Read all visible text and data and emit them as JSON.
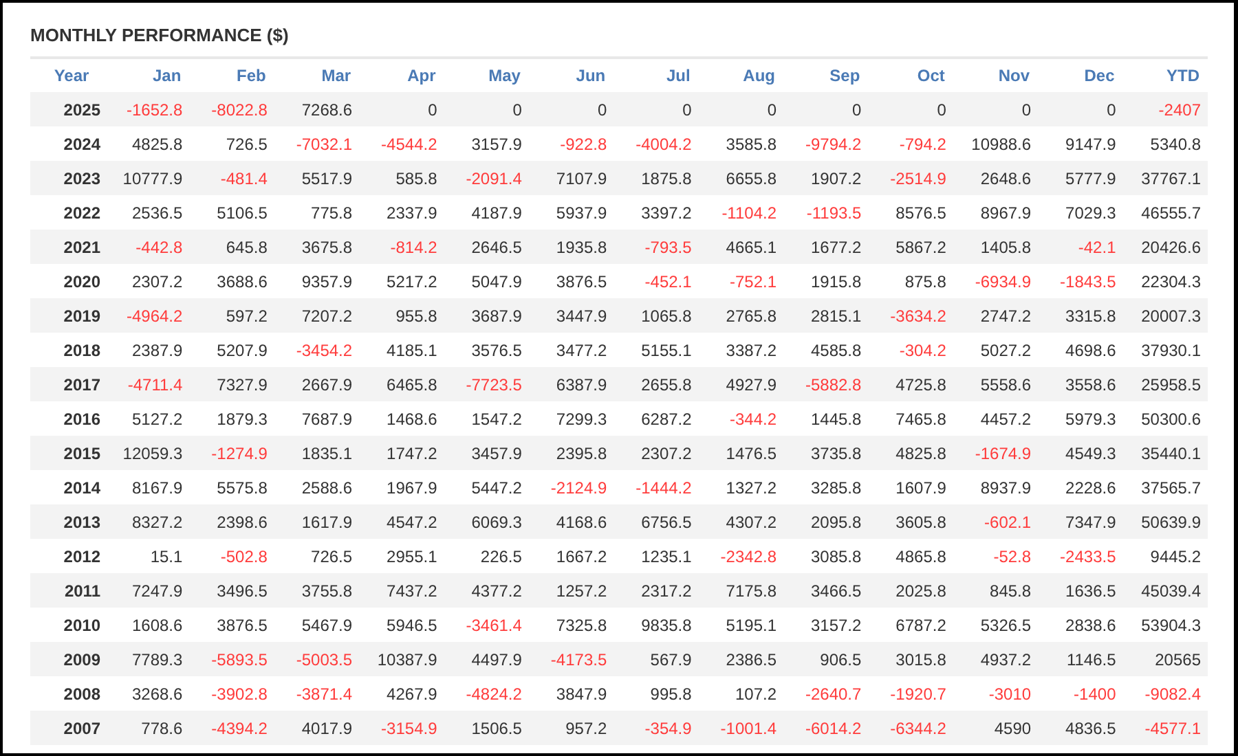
{
  "title": "MONTHLY PERFORMANCE ($)",
  "table": {
    "columns": [
      "Year",
      "Jan",
      "Feb",
      "Mar",
      "Apr",
      "May",
      "Jun",
      "Jul",
      "Aug",
      "Sep",
      "Oct",
      "Nov",
      "Dec",
      "YTD"
    ],
    "rows": [
      {
        "cells": [
          {
            "kind": "year",
            "value": "2025",
            "negative": false
          },
          {
            "kind": "number",
            "value": "-1652.8",
            "negative": true
          },
          {
            "kind": "number",
            "value": "-8022.8",
            "negative": true
          },
          {
            "kind": "number",
            "value": "7268.6",
            "negative": false
          },
          {
            "kind": "number",
            "value": "0",
            "negative": false
          },
          {
            "kind": "number",
            "value": "0",
            "negative": false
          },
          {
            "kind": "number",
            "value": "0",
            "negative": false
          },
          {
            "kind": "number",
            "value": "0",
            "negative": false
          },
          {
            "kind": "number",
            "value": "0",
            "negative": false
          },
          {
            "kind": "number",
            "value": "0",
            "negative": false
          },
          {
            "kind": "number",
            "value": "0",
            "negative": false
          },
          {
            "kind": "number",
            "value": "0",
            "negative": false
          },
          {
            "kind": "number",
            "value": "0",
            "negative": false
          },
          {
            "kind": "number",
            "value": "-2407",
            "negative": true
          }
        ]
      },
      {
        "cells": [
          {
            "kind": "year",
            "value": "2024",
            "negative": false
          },
          {
            "kind": "number",
            "value": "4825.8",
            "negative": false
          },
          {
            "kind": "number",
            "value": "726.5",
            "negative": false
          },
          {
            "kind": "number",
            "value": "-7032.1",
            "negative": true
          },
          {
            "kind": "number",
            "value": "-4544.2",
            "negative": true
          },
          {
            "kind": "number",
            "value": "3157.9",
            "negative": false
          },
          {
            "kind": "number",
            "value": "-922.8",
            "negative": true
          },
          {
            "kind": "number",
            "value": "-4004.2",
            "negative": true
          },
          {
            "kind": "number",
            "value": "3585.8",
            "negative": false
          },
          {
            "kind": "number",
            "value": "-9794.2",
            "negative": true
          },
          {
            "kind": "number",
            "value": "-794.2",
            "negative": true
          },
          {
            "kind": "number",
            "value": "10988.6",
            "negative": false
          },
          {
            "kind": "number",
            "value": "9147.9",
            "negative": false
          },
          {
            "kind": "number",
            "value": "5340.8",
            "negative": false
          }
        ]
      },
      {
        "cells": [
          {
            "kind": "year",
            "value": "2023",
            "negative": false
          },
          {
            "kind": "number",
            "value": "10777.9",
            "negative": false
          },
          {
            "kind": "number",
            "value": "-481.4",
            "negative": true
          },
          {
            "kind": "number",
            "value": "5517.9",
            "negative": false
          },
          {
            "kind": "number",
            "value": "585.8",
            "negative": false
          },
          {
            "kind": "number",
            "value": "-2091.4",
            "negative": true
          },
          {
            "kind": "number",
            "value": "7107.9",
            "negative": false
          },
          {
            "kind": "number",
            "value": "1875.8",
            "negative": false
          },
          {
            "kind": "number",
            "value": "6655.8",
            "negative": false
          },
          {
            "kind": "number",
            "value": "1907.2",
            "negative": false
          },
          {
            "kind": "number",
            "value": "-2514.9",
            "negative": true
          },
          {
            "kind": "number",
            "value": "2648.6",
            "negative": false
          },
          {
            "kind": "number",
            "value": "5777.9",
            "negative": false
          },
          {
            "kind": "number",
            "value": "37767.1",
            "negative": false
          }
        ]
      },
      {
        "cells": [
          {
            "kind": "year",
            "value": "2022",
            "negative": false
          },
          {
            "kind": "number",
            "value": "2536.5",
            "negative": false
          },
          {
            "kind": "number",
            "value": "5106.5",
            "negative": false
          },
          {
            "kind": "number",
            "value": "775.8",
            "negative": false
          },
          {
            "kind": "number",
            "value": "2337.9",
            "negative": false
          },
          {
            "kind": "number",
            "value": "4187.9",
            "negative": false
          },
          {
            "kind": "number",
            "value": "5937.9",
            "negative": false
          },
          {
            "kind": "number",
            "value": "3397.2",
            "negative": false
          },
          {
            "kind": "number",
            "value": "-1104.2",
            "negative": true
          },
          {
            "kind": "number",
            "value": "-1193.5",
            "negative": true
          },
          {
            "kind": "number",
            "value": "8576.5",
            "negative": false
          },
          {
            "kind": "number",
            "value": "8967.9",
            "negative": false
          },
          {
            "kind": "number",
            "value": "7029.3",
            "negative": false
          },
          {
            "kind": "number",
            "value": "46555.7",
            "negative": false
          }
        ]
      },
      {
        "cells": [
          {
            "kind": "year",
            "value": "2021",
            "negative": false
          },
          {
            "kind": "number",
            "value": "-442.8",
            "negative": true
          },
          {
            "kind": "number",
            "value": "645.8",
            "negative": false
          },
          {
            "kind": "number",
            "value": "3675.8",
            "negative": false
          },
          {
            "kind": "number",
            "value": "-814.2",
            "negative": true
          },
          {
            "kind": "number",
            "value": "2646.5",
            "negative": false
          },
          {
            "kind": "number",
            "value": "1935.8",
            "negative": false
          },
          {
            "kind": "number",
            "value": "-793.5",
            "negative": true
          },
          {
            "kind": "number",
            "value": "4665.1",
            "negative": false
          },
          {
            "kind": "number",
            "value": "1677.2",
            "negative": false
          },
          {
            "kind": "number",
            "value": "5867.2",
            "negative": false
          },
          {
            "kind": "number",
            "value": "1405.8",
            "negative": false
          },
          {
            "kind": "number",
            "value": "-42.1",
            "negative": true
          },
          {
            "kind": "number",
            "value": "20426.6",
            "negative": false
          }
        ]
      },
      {
        "cells": [
          {
            "kind": "year",
            "value": "2020",
            "negative": false
          },
          {
            "kind": "number",
            "value": "2307.2",
            "negative": false
          },
          {
            "kind": "number",
            "value": "3688.6",
            "negative": false
          },
          {
            "kind": "number",
            "value": "9357.9",
            "negative": false
          },
          {
            "kind": "number",
            "value": "5217.2",
            "negative": false
          },
          {
            "kind": "number",
            "value": "5047.9",
            "negative": false
          },
          {
            "kind": "number",
            "value": "3876.5",
            "negative": false
          },
          {
            "kind": "number",
            "value": "-452.1",
            "negative": true
          },
          {
            "kind": "number",
            "value": "-752.1",
            "negative": true
          },
          {
            "kind": "number",
            "value": "1915.8",
            "negative": false
          },
          {
            "kind": "number",
            "value": "875.8",
            "negative": false
          },
          {
            "kind": "number",
            "value": "-6934.9",
            "negative": true
          },
          {
            "kind": "number",
            "value": "-1843.5",
            "negative": true
          },
          {
            "kind": "number",
            "value": "22304.3",
            "negative": false
          }
        ]
      },
      {
        "cells": [
          {
            "kind": "year",
            "value": "2019",
            "negative": false
          },
          {
            "kind": "number",
            "value": "-4964.2",
            "negative": true
          },
          {
            "kind": "number",
            "value": "597.2",
            "negative": false
          },
          {
            "kind": "number",
            "value": "7207.2",
            "negative": false
          },
          {
            "kind": "number",
            "value": "955.8",
            "negative": false
          },
          {
            "kind": "number",
            "value": "3687.9",
            "negative": false
          },
          {
            "kind": "number",
            "value": "3447.9",
            "negative": false
          },
          {
            "kind": "number",
            "value": "1065.8",
            "negative": false
          },
          {
            "kind": "number",
            "value": "2765.8",
            "negative": false
          },
          {
            "kind": "number",
            "value": "2815.1",
            "negative": false
          },
          {
            "kind": "number",
            "value": "-3634.2",
            "negative": true
          },
          {
            "kind": "number",
            "value": "2747.2",
            "negative": false
          },
          {
            "kind": "number",
            "value": "3315.8",
            "negative": false
          },
          {
            "kind": "number",
            "value": "20007.3",
            "negative": false
          }
        ]
      },
      {
        "cells": [
          {
            "kind": "year",
            "value": "2018",
            "negative": false
          },
          {
            "kind": "number",
            "value": "2387.9",
            "negative": false
          },
          {
            "kind": "number",
            "value": "5207.9",
            "negative": false
          },
          {
            "kind": "number",
            "value": "-3454.2",
            "negative": true
          },
          {
            "kind": "number",
            "value": "4185.1",
            "negative": false
          },
          {
            "kind": "number",
            "value": "3576.5",
            "negative": false
          },
          {
            "kind": "number",
            "value": "3477.2",
            "negative": false
          },
          {
            "kind": "number",
            "value": "5155.1",
            "negative": false
          },
          {
            "kind": "number",
            "value": "3387.2",
            "negative": false
          },
          {
            "kind": "number",
            "value": "4585.8",
            "negative": false
          },
          {
            "kind": "number",
            "value": "-304.2",
            "negative": true
          },
          {
            "kind": "number",
            "value": "5027.2",
            "negative": false
          },
          {
            "kind": "number",
            "value": "4698.6",
            "negative": false
          },
          {
            "kind": "number",
            "value": "37930.1",
            "negative": false
          }
        ]
      },
      {
        "cells": [
          {
            "kind": "year",
            "value": "2017",
            "negative": false
          },
          {
            "kind": "number",
            "value": "-4711.4",
            "negative": true
          },
          {
            "kind": "number",
            "value": "7327.9",
            "negative": false
          },
          {
            "kind": "number",
            "value": "2667.9",
            "negative": false
          },
          {
            "kind": "number",
            "value": "6465.8",
            "negative": false
          },
          {
            "kind": "number",
            "value": "-7723.5",
            "negative": true
          },
          {
            "kind": "number",
            "value": "6387.9",
            "negative": false
          },
          {
            "kind": "number",
            "value": "2655.8",
            "negative": false
          },
          {
            "kind": "number",
            "value": "4927.9",
            "negative": false
          },
          {
            "kind": "number",
            "value": "-5882.8",
            "negative": true
          },
          {
            "kind": "number",
            "value": "4725.8",
            "negative": false
          },
          {
            "kind": "number",
            "value": "5558.6",
            "negative": false
          },
          {
            "kind": "number",
            "value": "3558.6",
            "negative": false
          },
          {
            "kind": "number",
            "value": "25958.5",
            "negative": false
          }
        ]
      },
      {
        "cells": [
          {
            "kind": "year",
            "value": "2016",
            "negative": false
          },
          {
            "kind": "number",
            "value": "5127.2",
            "negative": false
          },
          {
            "kind": "number",
            "value": "1879.3",
            "negative": false
          },
          {
            "kind": "number",
            "value": "7687.9",
            "negative": false
          },
          {
            "kind": "number",
            "value": "1468.6",
            "negative": false
          },
          {
            "kind": "number",
            "value": "1547.2",
            "negative": false
          },
          {
            "kind": "number",
            "value": "7299.3",
            "negative": false
          },
          {
            "kind": "number",
            "value": "6287.2",
            "negative": false
          },
          {
            "kind": "number",
            "value": "-344.2",
            "negative": true
          },
          {
            "kind": "number",
            "value": "1445.8",
            "negative": false
          },
          {
            "kind": "number",
            "value": "7465.8",
            "negative": false
          },
          {
            "kind": "number",
            "value": "4457.2",
            "negative": false
          },
          {
            "kind": "number",
            "value": "5979.3",
            "negative": false
          },
          {
            "kind": "number",
            "value": "50300.6",
            "negative": false
          }
        ]
      },
      {
        "cells": [
          {
            "kind": "year",
            "value": "2015",
            "negative": false
          },
          {
            "kind": "number",
            "value": "12059.3",
            "negative": false
          },
          {
            "kind": "number",
            "value": "-1274.9",
            "negative": true
          },
          {
            "kind": "number",
            "value": "1835.1",
            "negative": false
          },
          {
            "kind": "number",
            "value": "1747.2",
            "negative": false
          },
          {
            "kind": "number",
            "value": "3457.9",
            "negative": false
          },
          {
            "kind": "number",
            "value": "2395.8",
            "negative": false
          },
          {
            "kind": "number",
            "value": "2307.2",
            "negative": false
          },
          {
            "kind": "number",
            "value": "1476.5",
            "negative": false
          },
          {
            "kind": "number",
            "value": "3735.8",
            "negative": false
          },
          {
            "kind": "number",
            "value": "4825.8",
            "negative": false
          },
          {
            "kind": "number",
            "value": "-1674.9",
            "negative": true
          },
          {
            "kind": "number",
            "value": "4549.3",
            "negative": false
          },
          {
            "kind": "number",
            "value": "35440.1",
            "negative": false
          }
        ]
      },
      {
        "cells": [
          {
            "kind": "year",
            "value": "2014",
            "negative": false
          },
          {
            "kind": "number",
            "value": "8167.9",
            "negative": false
          },
          {
            "kind": "number",
            "value": "5575.8",
            "negative": false
          },
          {
            "kind": "number",
            "value": "2588.6",
            "negative": false
          },
          {
            "kind": "number",
            "value": "1967.9",
            "negative": false
          },
          {
            "kind": "number",
            "value": "5447.2",
            "negative": false
          },
          {
            "kind": "number",
            "value": "-2124.9",
            "negative": true
          },
          {
            "kind": "number",
            "value": "-1444.2",
            "negative": true
          },
          {
            "kind": "number",
            "value": "1327.2",
            "negative": false
          },
          {
            "kind": "number",
            "value": "3285.8",
            "negative": false
          },
          {
            "kind": "number",
            "value": "1607.9",
            "negative": false
          },
          {
            "kind": "number",
            "value": "8937.9",
            "negative": false
          },
          {
            "kind": "number",
            "value": "2228.6",
            "negative": false
          },
          {
            "kind": "number",
            "value": "37565.7",
            "negative": false
          }
        ]
      },
      {
        "cells": [
          {
            "kind": "year",
            "value": "2013",
            "negative": false
          },
          {
            "kind": "number",
            "value": "8327.2",
            "negative": false
          },
          {
            "kind": "number",
            "value": "2398.6",
            "negative": false
          },
          {
            "kind": "number",
            "value": "1617.9",
            "negative": false
          },
          {
            "kind": "number",
            "value": "4547.2",
            "negative": false
          },
          {
            "kind": "number",
            "value": "6069.3",
            "negative": false
          },
          {
            "kind": "number",
            "value": "4168.6",
            "negative": false
          },
          {
            "kind": "number",
            "value": "6756.5",
            "negative": false
          },
          {
            "kind": "number",
            "value": "4307.2",
            "negative": false
          },
          {
            "kind": "number",
            "value": "2095.8",
            "negative": false
          },
          {
            "kind": "number",
            "value": "3605.8",
            "negative": false
          },
          {
            "kind": "number",
            "value": "-602.1",
            "negative": true
          },
          {
            "kind": "number",
            "value": "7347.9",
            "negative": false
          },
          {
            "kind": "number",
            "value": "50639.9",
            "negative": false
          }
        ]
      },
      {
        "cells": [
          {
            "kind": "year",
            "value": "2012",
            "negative": false
          },
          {
            "kind": "number",
            "value": "15.1",
            "negative": false
          },
          {
            "kind": "number",
            "value": "-502.8",
            "negative": true
          },
          {
            "kind": "number",
            "value": "726.5",
            "negative": false
          },
          {
            "kind": "number",
            "value": "2955.1",
            "negative": false
          },
          {
            "kind": "number",
            "value": "226.5",
            "negative": false
          },
          {
            "kind": "number",
            "value": "1667.2",
            "negative": false
          },
          {
            "kind": "number",
            "value": "1235.1",
            "negative": false
          },
          {
            "kind": "number",
            "value": "-2342.8",
            "negative": true
          },
          {
            "kind": "number",
            "value": "3085.8",
            "negative": false
          },
          {
            "kind": "number",
            "value": "4865.8",
            "negative": false
          },
          {
            "kind": "number",
            "value": "-52.8",
            "negative": true
          },
          {
            "kind": "number",
            "value": "-2433.5",
            "negative": true
          },
          {
            "kind": "number",
            "value": "9445.2",
            "negative": false
          }
        ]
      },
      {
        "cells": [
          {
            "kind": "year",
            "value": "2011",
            "negative": false
          },
          {
            "kind": "number",
            "value": "7247.9",
            "negative": false
          },
          {
            "kind": "number",
            "value": "3496.5",
            "negative": false
          },
          {
            "kind": "number",
            "value": "3755.8",
            "negative": false
          },
          {
            "kind": "number",
            "value": "7437.2",
            "negative": false
          },
          {
            "kind": "number",
            "value": "4377.2",
            "negative": false
          },
          {
            "kind": "number",
            "value": "1257.2",
            "negative": false
          },
          {
            "kind": "number",
            "value": "2317.2",
            "negative": false
          },
          {
            "kind": "number",
            "value": "7175.8",
            "negative": false
          },
          {
            "kind": "number",
            "value": "3466.5",
            "negative": false
          },
          {
            "kind": "number",
            "value": "2025.8",
            "negative": false
          },
          {
            "kind": "number",
            "value": "845.8",
            "negative": false
          },
          {
            "kind": "number",
            "value": "1636.5",
            "negative": false
          },
          {
            "kind": "number",
            "value": "45039.4",
            "negative": false
          }
        ]
      },
      {
        "cells": [
          {
            "kind": "year",
            "value": "2010",
            "negative": false
          },
          {
            "kind": "number",
            "value": "1608.6",
            "negative": false
          },
          {
            "kind": "number",
            "value": "3876.5",
            "negative": false
          },
          {
            "kind": "number",
            "value": "5467.9",
            "negative": false
          },
          {
            "kind": "number",
            "value": "5946.5",
            "negative": false
          },
          {
            "kind": "number",
            "value": "-3461.4",
            "negative": true
          },
          {
            "kind": "number",
            "value": "7325.8",
            "negative": false
          },
          {
            "kind": "number",
            "value": "9835.8",
            "negative": false
          },
          {
            "kind": "number",
            "value": "5195.1",
            "negative": false
          },
          {
            "kind": "number",
            "value": "3157.2",
            "negative": false
          },
          {
            "kind": "number",
            "value": "6787.2",
            "negative": false
          },
          {
            "kind": "number",
            "value": "5326.5",
            "negative": false
          },
          {
            "kind": "number",
            "value": "2838.6",
            "negative": false
          },
          {
            "kind": "number",
            "value": "53904.3",
            "negative": false
          }
        ]
      },
      {
        "cells": [
          {
            "kind": "year",
            "value": "2009",
            "negative": false
          },
          {
            "kind": "number",
            "value": "7789.3",
            "negative": false
          },
          {
            "kind": "number",
            "value": "-5893.5",
            "negative": true
          },
          {
            "kind": "number",
            "value": "-5003.5",
            "negative": true
          },
          {
            "kind": "number",
            "value": "10387.9",
            "negative": false
          },
          {
            "kind": "number",
            "value": "4497.9",
            "negative": false
          },
          {
            "kind": "number",
            "value": "-4173.5",
            "negative": true
          },
          {
            "kind": "number",
            "value": "567.9",
            "negative": false
          },
          {
            "kind": "number",
            "value": "2386.5",
            "negative": false
          },
          {
            "kind": "number",
            "value": "906.5",
            "negative": false
          },
          {
            "kind": "number",
            "value": "3015.8",
            "negative": false
          },
          {
            "kind": "number",
            "value": "4937.2",
            "negative": false
          },
          {
            "kind": "number",
            "value": "1146.5",
            "negative": false
          },
          {
            "kind": "number",
            "value": "20565",
            "negative": false
          }
        ]
      },
      {
        "cells": [
          {
            "kind": "year",
            "value": "2008",
            "negative": false
          },
          {
            "kind": "number",
            "value": "3268.6",
            "negative": false
          },
          {
            "kind": "number",
            "value": "-3902.8",
            "negative": true
          },
          {
            "kind": "number",
            "value": "-3871.4",
            "negative": true
          },
          {
            "kind": "number",
            "value": "4267.9",
            "negative": false
          },
          {
            "kind": "number",
            "value": "-4824.2",
            "negative": true
          },
          {
            "kind": "number",
            "value": "3847.9",
            "negative": false
          },
          {
            "kind": "number",
            "value": "995.8",
            "negative": false
          },
          {
            "kind": "number",
            "value": "107.2",
            "negative": false
          },
          {
            "kind": "number",
            "value": "-2640.7",
            "negative": true
          },
          {
            "kind": "number",
            "value": "-1920.7",
            "negative": true
          },
          {
            "kind": "number",
            "value": "-3010",
            "negative": true
          },
          {
            "kind": "number",
            "value": "-1400",
            "negative": true
          },
          {
            "kind": "number",
            "value": "-9082.4",
            "negative": true
          }
        ]
      },
      {
        "cells": [
          {
            "kind": "year",
            "value": "2007",
            "negative": false
          },
          {
            "kind": "number",
            "value": "778.6",
            "negative": false
          },
          {
            "kind": "number",
            "value": "-4394.2",
            "negative": true
          },
          {
            "kind": "number",
            "value": "4017.9",
            "negative": false
          },
          {
            "kind": "number",
            "value": "-3154.9",
            "negative": true
          },
          {
            "kind": "number",
            "value": "1506.5",
            "negative": false
          },
          {
            "kind": "number",
            "value": "957.2",
            "negative": false
          },
          {
            "kind": "number",
            "value": "-354.9",
            "negative": true
          },
          {
            "kind": "number",
            "value": "-1001.4",
            "negative": true
          },
          {
            "kind": "number",
            "value": "-6014.2",
            "negative": true
          },
          {
            "kind": "number",
            "value": "-6344.2",
            "negative": true
          },
          {
            "kind": "number",
            "value": "4590",
            "negative": false
          },
          {
            "kind": "number",
            "value": "4836.5",
            "negative": false
          },
          {
            "kind": "number",
            "value": "-4577.1",
            "negative": true
          }
        ]
      }
    ]
  }
}
